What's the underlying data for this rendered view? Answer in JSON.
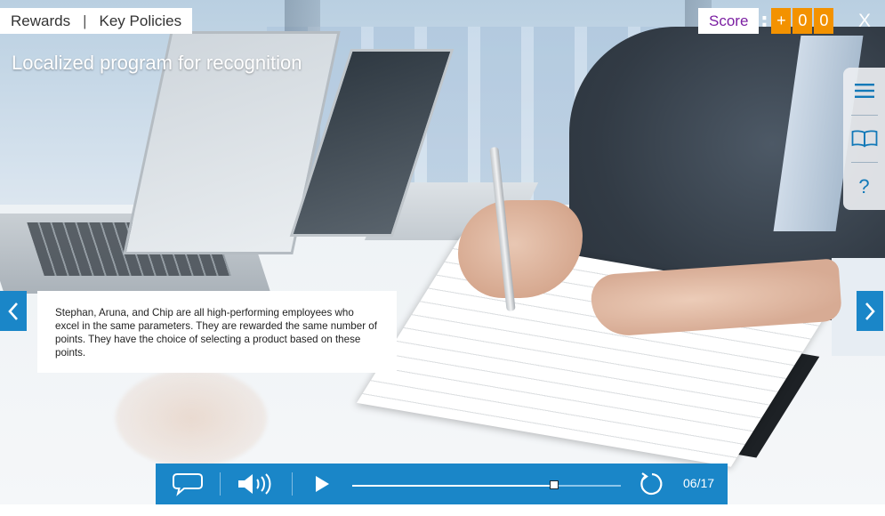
{
  "breadcrumb": {
    "section": "Rewards",
    "separator": "|",
    "page": "Key Policies"
  },
  "slide": {
    "title": "Localized program for recognition"
  },
  "score": {
    "label": "Score",
    "digits": [
      "+",
      "0",
      "0"
    ],
    "accent": "#f39200",
    "label_color": "#7b1fa2"
  },
  "close": {
    "label": "X"
  },
  "side_menu": {
    "items": [
      {
        "icon": "menu-icon"
      },
      {
        "icon": "book-icon"
      },
      {
        "icon": "help-icon",
        "label": "?"
      }
    ]
  },
  "caption": {
    "text": "Stephan, Aruna, and Chip are all high-performing employees who excel in the same parameters. They are rewarded the same number of points. They have the choice of selecting a product based on these points."
  },
  "player": {
    "buttons": [
      "comment-icon",
      "volume-icon",
      "play-icon",
      "replay-icon"
    ],
    "progress": 0.75,
    "page_count": "06/17",
    "accent": "#1a86c8"
  }
}
